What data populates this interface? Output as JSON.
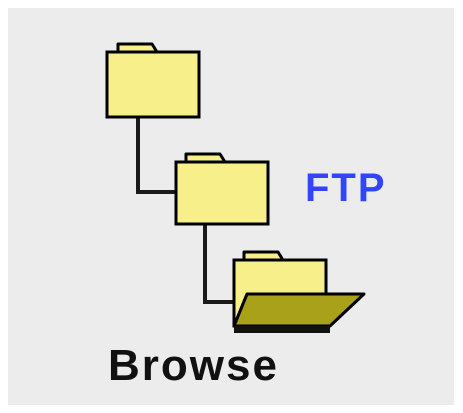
{
  "icon": {
    "name": "ftp-browse-icon",
    "label_ftp": "FTP",
    "label_browse": "Browse",
    "colors": {
      "background": "#ececec",
      "folder_fill": "#f7ef8a",
      "folder_open_fill": "#a9a11a",
      "outline": "#000000",
      "ftp_text": "#3344ff",
      "browse_text": "#111111"
    }
  }
}
